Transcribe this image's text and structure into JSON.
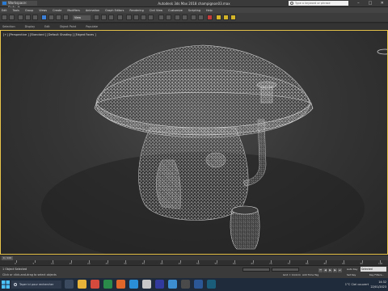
{
  "window": {
    "workspace_label": "Workspace: Default",
    "title": "Autodesk 3ds Max 2018    champignon03.max",
    "search_placeholder": "Type a keyword or phrase",
    "window_buttons": [
      "–",
      "□",
      "✕"
    ]
  },
  "menubar": {
    "items": [
      "Edit",
      "Tools",
      "Group",
      "Views",
      "Create",
      "Modifiers",
      "Animation",
      "Graph Editors",
      "Rendering",
      "Civil View",
      "Customize",
      "Scripting",
      "Help"
    ]
  },
  "toolbar": {
    "view_select": "View"
  },
  "ribbon": {
    "items": [
      "Selection",
      "Display",
      "Edit",
      "Object Paint",
      "Populate"
    ]
  },
  "viewport": {
    "label": "[+] [Perspective ] [Standard ] [Default Shading ] [Edged Faces ]"
  },
  "timeline": {
    "frame_display": "0 / 100",
    "ticks": [
      "0",
      "5",
      "10",
      "15",
      "20",
      "25",
      "30",
      "35",
      "40",
      "45",
      "50",
      "55",
      "60",
      "65",
      "70",
      "75",
      "80",
      "85",
      "90",
      "95",
      "100"
    ]
  },
  "status": {
    "line1": "1 Object Selected",
    "line2": "Click or click-and-drag to select objects",
    "grid": "Grid = 10,0cm",
    "add_time_tag": "Add Time Tag",
    "auto_key": "Auto Key",
    "selected": "Selected",
    "set_key": "Set Key",
    "key_filters": "Key Filters..."
  },
  "taskbar": {
    "search_text": "Taper ici pour rechercher",
    "weather": "1°C  Ciel couvert",
    "time": "14:32",
    "date": "22/01/2023"
  },
  "colors": {
    "viewport_border": "#e8c54a",
    "wireframe": "#d8d8d8",
    "accent_blue": "#3b7fd6"
  }
}
